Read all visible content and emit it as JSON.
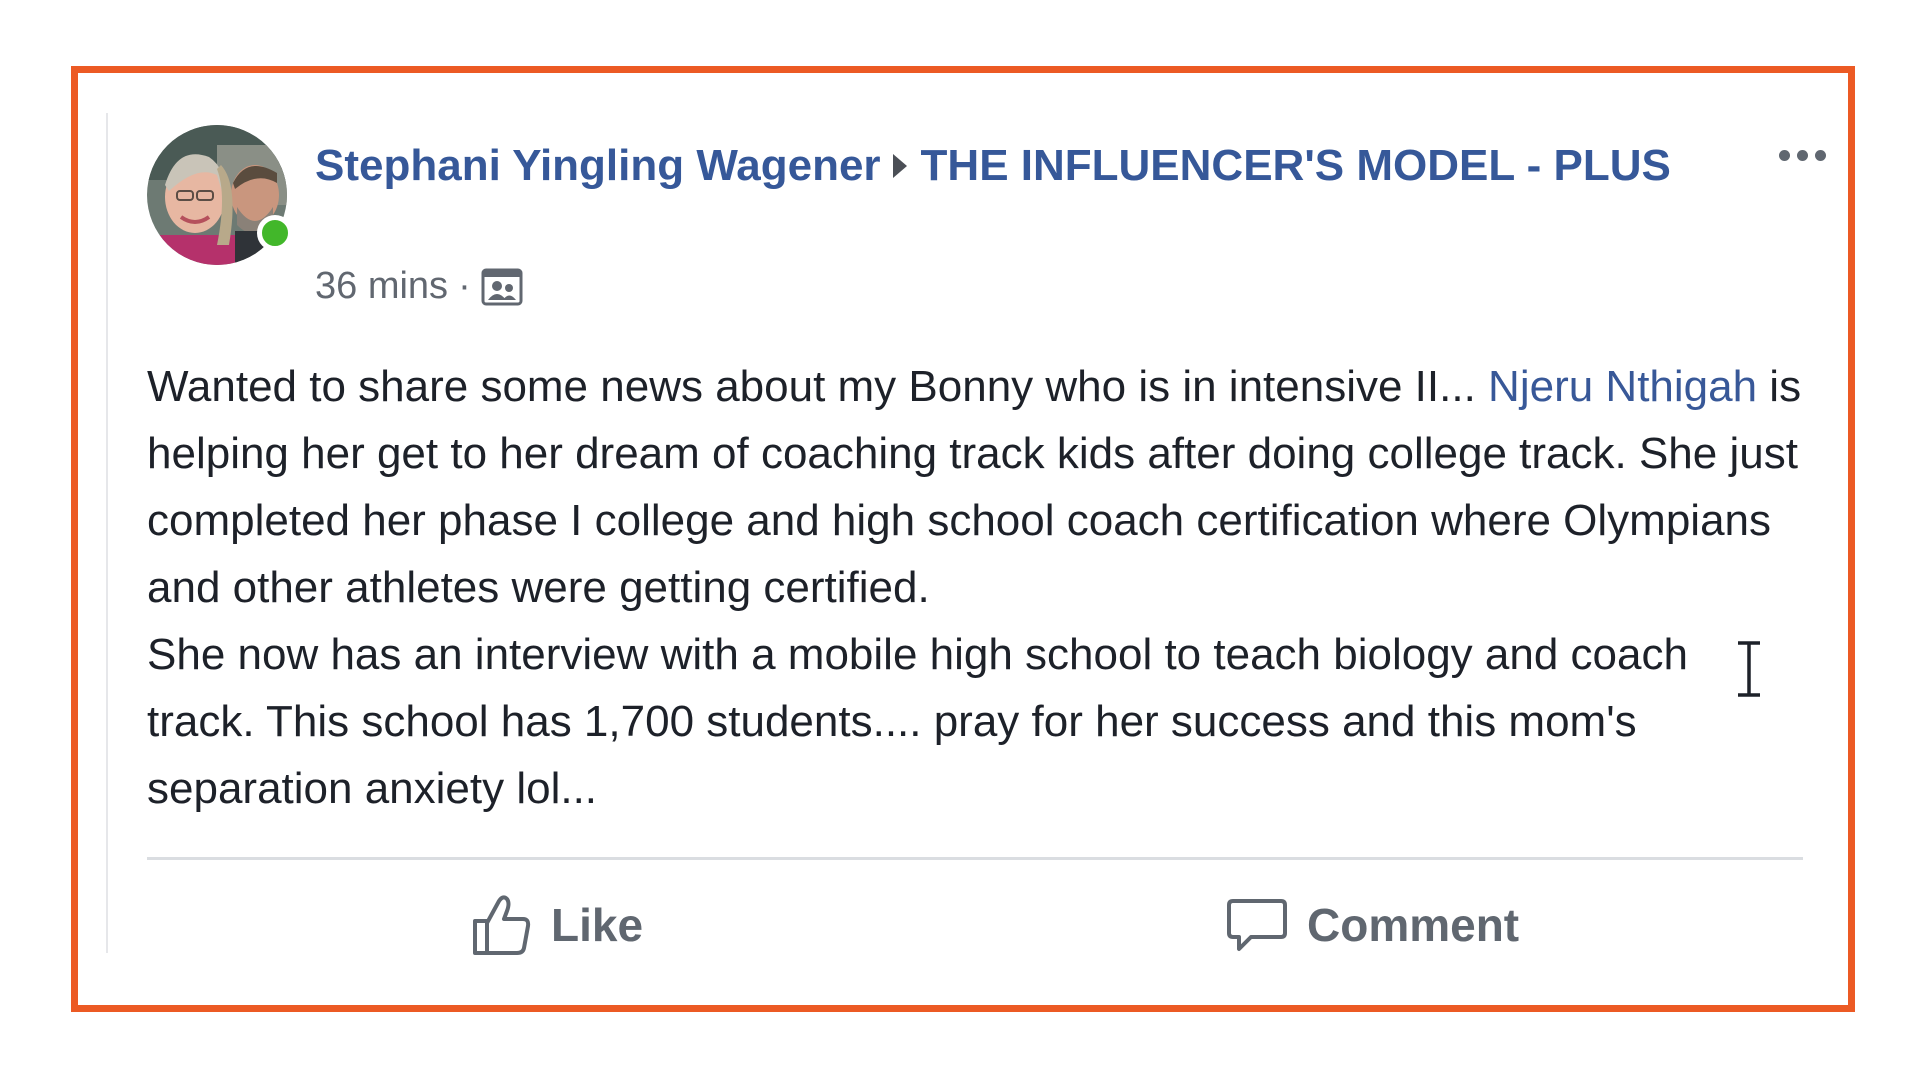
{
  "post": {
    "author": "Stephani Yingling Wagener",
    "group": "THE INFLUENCER'S MODEL - PLUS",
    "timestamp": "36 mins",
    "meta_separator": "·",
    "privacy_icon": "group-privacy-icon",
    "body_parts": {
      "p1": "Wanted to share some news about my Bonny who is in intensive II... ",
      "mention": "Njeru Nthigah",
      "p2": " is helping her get to her dream of coaching track kids after doing college track. She just completed her phase I college and high school coach certification where Olympians and other athletes were getting certified.",
      "p3": "She now has an interview with a mobile high school to teach biology and coach track. This school has 1,700 students.... pray for her success and this mom's separation anxiety lol..."
    },
    "online": true
  },
  "actions": {
    "like_label": "Like",
    "comment_label": "Comment"
  },
  "colors": {
    "frame_border": "#ec5a24",
    "link_blue": "#365899",
    "online_green": "#42b72a",
    "action_gray": "#606770"
  }
}
